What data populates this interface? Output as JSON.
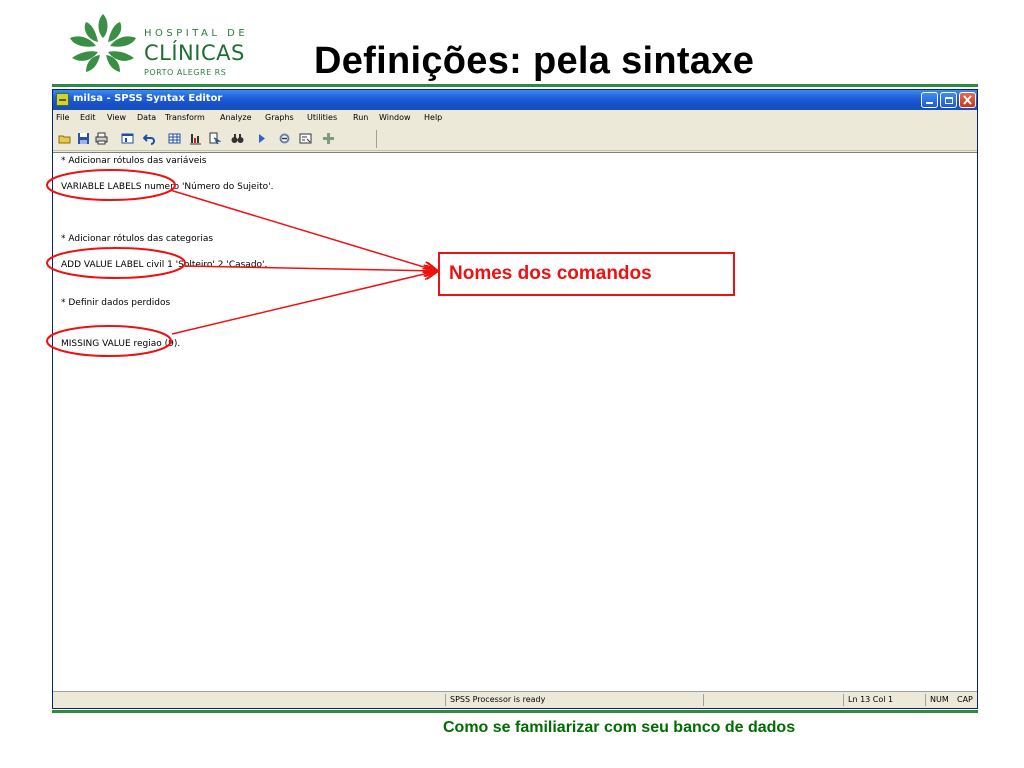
{
  "logo": {
    "line1": "HOSPITAL DE",
    "line2": "CLÍNICAS",
    "line3": "PORTO ALEGRE   RS",
    "color": "#2d7f3c"
  },
  "slide": {
    "title": "Definições: pela sintaxe",
    "footer": "Como se familiarizar com seu banco de dados"
  },
  "window": {
    "title": "milsa - SPSS Syntax Editor",
    "app_icon": "spss-syntax-icon",
    "controls": [
      "minimize-icon",
      "restore-icon",
      "close-icon"
    ]
  },
  "menu": [
    "File",
    "Edit",
    "View",
    "Data",
    "Transform",
    "Analyze",
    "Graphs",
    "Utilities",
    "Run",
    "Window",
    "Help"
  ],
  "toolbar": [
    "open-icon",
    "save-icon",
    "print-icon",
    "dialog-recall-icon",
    "undo-icon",
    "goto-data-icon",
    "variables-icon",
    "go-to-case-icon",
    "find-icon",
    "run-icon",
    "sync-viewer-icon",
    "syntax-help-icon",
    "designate-window-icon"
  ],
  "editor": {
    "lines": [
      "* Adicionar rótulos das variáveis",
      "VARIABLE LABELS numero 'Número do Sujeito'.",
      "* Adicionar rótulos das categorias",
      "ADD VALUE LABEL civil 1 'Solteiro' 2 'Casado'.",
      "* Definir dados perdidos",
      "MISSING VALUE regiao (9)."
    ]
  },
  "status": {
    "message": "SPSS Processor is ready",
    "position": "Ln 13 Col 1",
    "num": "NUM",
    "cap": "CAP"
  },
  "annotation": {
    "callout": "Nomes dos comandos",
    "color": "#ee1111"
  }
}
